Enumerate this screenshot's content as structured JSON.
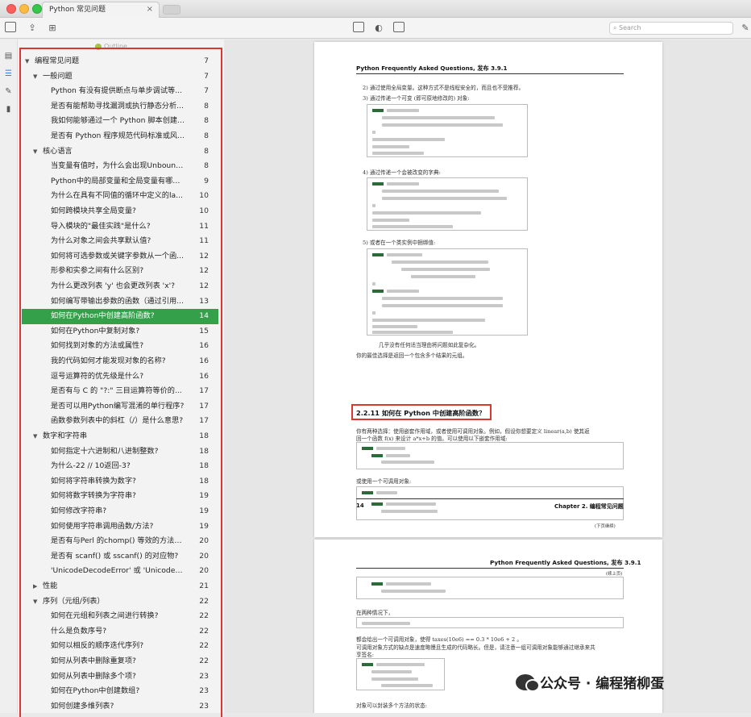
{
  "window": {
    "tab_title": "Python 常见问题",
    "tab_close": "×"
  },
  "toolbar": {
    "search_placeholder": "Search"
  },
  "sidebar": {
    "caption": "Outline",
    "items": [
      {
        "label": "编程常见问题",
        "page": "7",
        "level": 0,
        "expanded": true
      },
      {
        "label": "一般问题",
        "page": "7",
        "level": 1,
        "expanded": true
      },
      {
        "label": "Python 有没有提供断点与单步调试等...",
        "page": "7",
        "level": 2
      },
      {
        "label": "是否有能帮助寻找漏洞或执行静态分析...",
        "page": "8",
        "level": 2
      },
      {
        "label": "我如何能够通过一个 Python 脚本创建...",
        "page": "8",
        "level": 2
      },
      {
        "label": "是否有 Python 程序规范代码标准或风...",
        "page": "8",
        "level": 2
      },
      {
        "label": "核心语言",
        "page": "8",
        "level": 1,
        "expanded": true
      },
      {
        "label": "当变量有值时，为什么会出现Unbound...",
        "page": "8",
        "level": 2
      },
      {
        "label": "Python中的局部变量和全局变量有哪些...",
        "page": "9",
        "level": 2
      },
      {
        "label": "为什么在具有不同值的循环中定义的la...",
        "page": "10",
        "level": 2
      },
      {
        "label": "如何跨模块共享全局变量?",
        "page": "10",
        "level": 2
      },
      {
        "label": "导入模块的\"最佳实践\"是什么?",
        "page": "11",
        "level": 2
      },
      {
        "label": "为什么对象之间会共享默认值?",
        "page": "11",
        "level": 2
      },
      {
        "label": "如何将可选参数或关键字参数从一个函...",
        "page": "12",
        "level": 2
      },
      {
        "label": "形参和实参之间有什么区别?",
        "page": "12",
        "level": 2
      },
      {
        "label": "为什么更改列表 'y' 也会更改列表 'x'?",
        "page": "12",
        "level": 2
      },
      {
        "label": "如何编写带输出参数的函数（通过引用...",
        "page": "13",
        "level": 2
      },
      {
        "label": "如何在Python中创建高阶函数?",
        "page": "14",
        "level": 2,
        "selected": true
      },
      {
        "label": "如何在Python中复制对象?",
        "page": "15",
        "level": 2
      },
      {
        "label": "如何找到对象的方法或属性?",
        "page": "16",
        "level": 2
      },
      {
        "label": "我的代码如何才能发现对象的名称?",
        "page": "16",
        "level": 2
      },
      {
        "label": "逗号运算符的优先级是什么?",
        "page": "16",
        "level": 2
      },
      {
        "label": "是否有与 C 的 \"?:\" 三目运算符等价的...",
        "page": "17",
        "level": 2
      },
      {
        "label": "是否可以用Python编写混淆的单行程序?",
        "page": "17",
        "level": 2
      },
      {
        "label": "函数参数列表中的斜杠（/）是什么意思?",
        "page": "17",
        "level": 2
      },
      {
        "label": "数字和字符串",
        "page": "18",
        "level": 1,
        "expanded": true
      },
      {
        "label": "如何指定十六进制和八进制整数?",
        "page": "18",
        "level": 2
      },
      {
        "label": "为什么-22 // 10返回-3?",
        "page": "18",
        "level": 2
      },
      {
        "label": "如何将字符串转换为数字?",
        "page": "18",
        "level": 2
      },
      {
        "label": "如何将数字转换为字符串?",
        "page": "19",
        "level": 2
      },
      {
        "label": "如何修改字符串?",
        "page": "19",
        "level": 2
      },
      {
        "label": "如何使用字符串调用函数/方法?",
        "page": "19",
        "level": 2
      },
      {
        "label": "是否有与Perl 的chomp() 等效的方法，...",
        "page": "20",
        "level": 2
      },
      {
        "label": "是否有 scanf() 或 sscanf() 的对应物?",
        "page": "20",
        "level": 2
      },
      {
        "label": "'UnicodeDecodeError' 或 'UnicodeEnc...",
        "page": "20",
        "level": 2
      },
      {
        "label": "性能",
        "page": "21",
        "level": 1,
        "expanded": false
      },
      {
        "label": "序列（元组/列表）",
        "page": "22",
        "level": 1,
        "expanded": true
      },
      {
        "label": "如何在元组和列表之间进行转换?",
        "page": "22",
        "level": 2
      },
      {
        "label": "什么是负数序号?",
        "page": "22",
        "level": 2
      },
      {
        "label": "如何以相反的顺序迭代序列?",
        "page": "22",
        "level": 2
      },
      {
        "label": "如何从列表中删除重复项?",
        "page": "22",
        "level": 2
      },
      {
        "label": "如何从列表中删除多个项?",
        "page": "23",
        "level": 2
      },
      {
        "label": "如何在Python中创建数组?",
        "page": "23",
        "level": 2
      },
      {
        "label": "如何创建多维列表?",
        "page": "23",
        "level": 2
      }
    ]
  },
  "document": {
    "page1": {
      "header": "Python Frequently Asked Questions, 发布 3.9.1",
      "item2": "2) 通过使用全局变量。这种方式不是线程安全的，而且也不受推荐。",
      "item3": "3) 通过传递一个可变 (即可原地修改的) 对象:",
      "item4": "4) 通过传递一个会被改变的字典:",
      "item5": "5) 或者在一个类实例中捆绑值:",
      "note1": "几乎没有任何适当理由将问题如此复杂化。",
      "note2": "你的最佳选择是返回一个包含多个结果的元组。",
      "section_title": "2.2.11  如何在 Python 中创建高阶函数？",
      "para1": "你有两种选择：使用嵌套作用域，或者使用可调用对象。例如，假设你想要定义 linear(a,b) 使其返",
      "para2": "回一个函数 f(x) 来设计 a*x+b 的值。可以使用以下嵌套作用域:",
      "para3": "或使用一个可调用对象:",
      "continued": "(下页继续)",
      "page_number": "14",
      "chapter": "Chapter 2.  编程常见问题"
    },
    "page2": {
      "header": "Python Frequently Asked Questions, 发布 3.9.1",
      "continued_top": "(续上页)",
      "para1": "在两种情况下，",
      "para2": "都会给出一个可调用对象，使得 taxes(10e6) == 0.3 * 10e6 + 2 。",
      "para3": "可调用对象方式的缺点是速度略慢且生成的代码略长。但是，请注意一组可调用对象能够通过继承来共",
      "para4": "享签名:",
      "para5": "对象可以封装多个方法的状态:"
    }
  },
  "watermark": {
    "text": "公众号 · 编程猪柳蛋"
  }
}
